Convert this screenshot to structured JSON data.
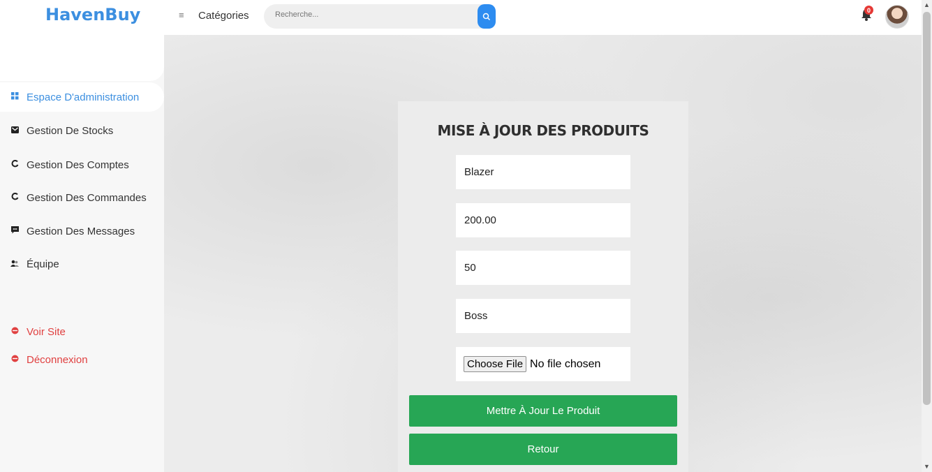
{
  "header": {
    "logo": "HavenBuy",
    "menu_icon": "≡",
    "categories_label": "Catégories",
    "search_placeholder": "Recherche...",
    "notification_count": "0"
  },
  "sidebar": {
    "items": [
      {
        "label": "Espace D'administration",
        "icon": "dashboard-icon",
        "glyph": "▪",
        "active": true
      },
      {
        "label": "Gestion De Stocks",
        "icon": "inbox-icon",
        "glyph": "▬"
      },
      {
        "label": "Gestion Des Comptes",
        "icon": "refresh-icon",
        "glyph": "↻"
      },
      {
        "label": "Gestion Des Commandes",
        "icon": "refresh-icon",
        "glyph": "↻"
      },
      {
        "label": "Gestion Des Messages",
        "icon": "message-icon",
        "glyph": "▪"
      },
      {
        "label": "Équipe",
        "icon": "team-icon",
        "glyph": "♟"
      },
      {
        "label": "Voir Site",
        "icon": "globe-icon",
        "glyph": "●"
      },
      {
        "label": "Déconnexion",
        "icon": "logout-icon",
        "glyph": "●"
      }
    ]
  },
  "form": {
    "title": "MISE À JOUR DES PRODUITS",
    "name_value": "Blazer",
    "price_value": "200.00",
    "quantity_value": "50",
    "brand_value": "Boss",
    "file_button": "Choose File",
    "file_status": "No file chosen",
    "submit_label": "Mettre À Jour Le Produit",
    "back_label": "Retour"
  },
  "colors": {
    "brand": "#3c8fe0",
    "button": "#27a655",
    "logout_red": "#e04040",
    "badge": "#e53935"
  }
}
